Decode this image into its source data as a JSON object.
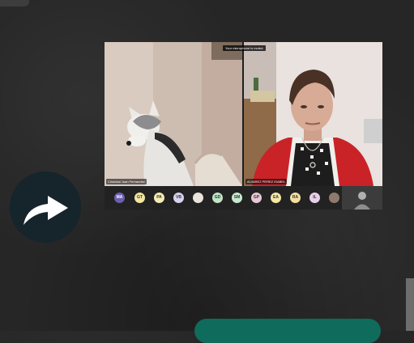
{
  "call": {
    "mute_notice": "Your microphone is muted.",
    "tile_left_name": "Cristobal Juan Fernandez",
    "tile_right_name": "ALVAREZ PEREZ ISABEL",
    "participants": [
      {
        "initials": "MA",
        "color": "#6c5fb0",
        "text_color": "#ffffff"
      },
      {
        "initials": "GT",
        "color": "#f2e6a1",
        "text_color": "#333333"
      },
      {
        "initials": "PA",
        "color": "#f3ecb3",
        "text_color": "#333333"
      },
      {
        "initials": "VB",
        "color": "#d8d2ee",
        "text_color": "#333333"
      },
      {
        "initials": "",
        "color": "#e8e3dc",
        "text_color": "#333333"
      },
      {
        "initials": "GD",
        "color": "#bfe5c5",
        "text_color": "#333333"
      },
      {
        "initials": "SM",
        "color": "#c6ead1",
        "text_color": "#333333"
      },
      {
        "initials": "GP",
        "color": "#e8c8d4",
        "text_color": "#333333"
      },
      {
        "initials": "EA",
        "color": "#f4e7a6",
        "text_color": "#333333"
      },
      {
        "initials": "RA",
        "color": "#f4df9e",
        "text_color": "#333333"
      },
      {
        "initials": "IL",
        "color": "#e9d0e9",
        "text_color": "#333333"
      },
      {
        "initials": "",
        "color": "#8f7a6c",
        "text_color": "#ffffff"
      }
    ]
  },
  "share": {
    "icon": "share-arrow-icon"
  }
}
